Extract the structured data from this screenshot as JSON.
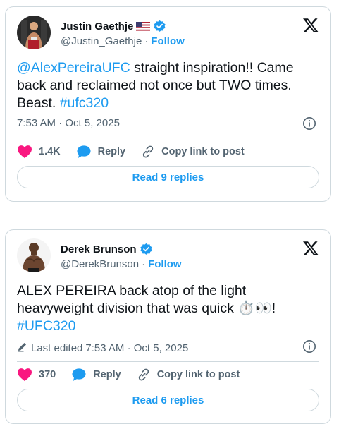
{
  "tweets": [
    {
      "author_name": "Justin Gaethje",
      "handle": "@Justin_Gaethje",
      "separator": "·",
      "follow_label": "Follow",
      "flag_icon": "us-flag-icon",
      "text_mention": "@AlexPereiraUFC",
      "text_body": " straight inspiration!! Came back and reclaimed not once but TWO times. Beast. ",
      "text_hashtag": "#ufc320",
      "timestamp": "7:53 AM · Oct 5, 2025",
      "likes": "1.4K",
      "reply_label": "Reply",
      "copy_label": "Copy link to post",
      "read_replies": "Read 9 replies"
    },
    {
      "author_name": "Derek Brunson",
      "handle": "@DerekBrunson",
      "separator": "·",
      "follow_label": "Follow",
      "text_body": "ALEX PEREIRA back atop of the light heavyweight division that was quick  ⏱️👀!",
      "text_hashtag": "#UFC320",
      "edited_label": "Last edited",
      "timestamp": "7:53 AM · Oct 5, 2025",
      "likes": "370",
      "reply_label": "Reply",
      "copy_label": "Copy link to post",
      "read_replies": "Read 6 replies"
    }
  ],
  "colors": {
    "accent": "#1d9bf0",
    "like": "#f91880",
    "muted": "#536471",
    "border": "#cfd9de"
  }
}
